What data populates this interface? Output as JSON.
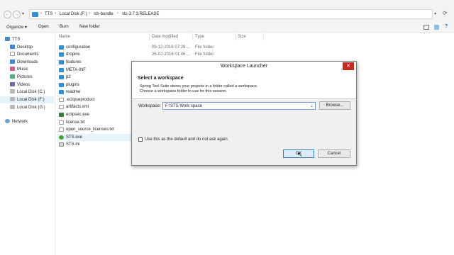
{
  "address": {
    "crumbs": [
      "TTS",
      "Local Disk (F:)",
      "sts-bundle",
      "sts-3.7.3.RELEASE"
    ]
  },
  "toolbar": {
    "organize": "Organize ▾",
    "open": "Open",
    "burn": "Burn",
    "new_folder": "New folder"
  },
  "nav": {
    "items": [
      "TTS",
      "Desktop",
      "Documents",
      "Downloads",
      "Music",
      "Pictures",
      "Videos",
      "Local Disk (C:)",
      "Local Disk (F:)",
      "Local Disk (G:)",
      "Network"
    ]
  },
  "columns": {
    "name": "Name",
    "date": "Date modified",
    "type": "Type",
    "size": "Size"
  },
  "files": [
    {
      "name": "configuration",
      "date": "09-12-2016 07:29 ...",
      "type": "File folder"
    },
    {
      "name": "dropins",
      "date": "25-02-2016 01:46 ...",
      "type": "File folder"
    },
    {
      "name": "features",
      "date": "",
      "type": ""
    },
    {
      "name": "META-INF",
      "date": "",
      "type": ""
    },
    {
      "name": "p2",
      "date": "",
      "type": ""
    },
    {
      "name": "plugins",
      "date": "",
      "type": ""
    },
    {
      "name": "readme",
      "date": "",
      "type": ""
    },
    {
      "name": ".eclipseproduct",
      "date": "",
      "type": ""
    },
    {
      "name": "artifacts.xml",
      "date": "",
      "type": ""
    },
    {
      "name": "eclipsec.exe",
      "date": "",
      "type": ""
    },
    {
      "name": "license.txt",
      "date": "",
      "type": ""
    },
    {
      "name": "open_source_licenses.txt",
      "date": "",
      "type": ""
    },
    {
      "name": "STS.exe",
      "date": "",
      "type": ""
    },
    {
      "name": "STS.ini",
      "date": "",
      "type": ""
    }
  ],
  "dialog": {
    "title": "Workspace Launcher",
    "close": "✕",
    "heading": "Select a workspace",
    "desc1": "Spring Tool Suite stores your projects in a folder called a workspace.",
    "desc2": "Choose a workspace folder to use for this session.",
    "workspace_label": "Workspace:",
    "workspace_value": "F:\\STS Work space",
    "browse": "Browse...",
    "default_checkbox": "Use this as the default and do not ask again",
    "ok": "OK",
    "cancel": "Cancel"
  }
}
